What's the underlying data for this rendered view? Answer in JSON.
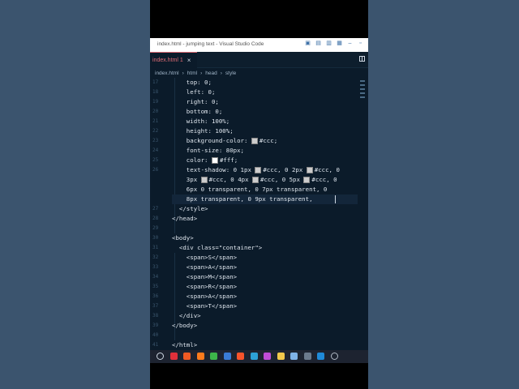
{
  "window": {
    "title": "index.html - jumping text - Visual Studio Code"
  },
  "tab": {
    "label": "index.html 1",
    "close": "×"
  },
  "breadcrumb": {
    "file": "index.html",
    "sep1": "›",
    "item1": "html",
    "sep2": "›",
    "item2": "head",
    "sep3": "›",
    "item3": "style"
  },
  "code_lines": [
    {
      "num": "17",
      "text": "    top: 0;"
    },
    {
      "num": "18",
      "text": "    left: 0;"
    },
    {
      "num": "19",
      "text": "    right: 0;"
    },
    {
      "num": "20",
      "text": "    bottom: 0;"
    },
    {
      "num": "21",
      "text": "    width: 100%;"
    },
    {
      "num": "22",
      "text": "    height: 100%;"
    },
    {
      "num": "23",
      "text": "    background-color: ■#ccc;"
    },
    {
      "num": "24",
      "text": "    font-size: 80px;"
    },
    {
      "num": "25",
      "text": "    color: ■#fff;"
    },
    {
      "num": "26",
      "text": "    text-shadow: 0 1px ■#ccc, 0 2px ■#ccc, 0"
    },
    {
      "num": "",
      "text": "    3px ■#ccc, 0 4px ■#ccc, 0 5px ■#ccc, 0"
    },
    {
      "num": "",
      "text": "    6px 0 transparent, 0 7px transparent, 0"
    },
    {
      "num": "",
      "text": "    8px transparent, 0 9px transparent,"
    },
    {
      "num": "27",
      "text": "  </style>"
    },
    {
      "num": "28",
      "text": "</head>"
    },
    {
      "num": "29",
      "text": ""
    },
    {
      "num": "30",
      "text": "<body>"
    },
    {
      "num": "31",
      "text": "  <div class=\"container\">"
    },
    {
      "num": "32",
      "text": "    <span>S</span>"
    },
    {
      "num": "33",
      "text": "    <span>A</span>"
    },
    {
      "num": "34",
      "text": "    <span>M</span>"
    },
    {
      "num": "35",
      "text": "    <span>R</span>"
    },
    {
      "num": "36",
      "text": "    <span>A</span>"
    },
    {
      "num": "37",
      "text": "    <span>T</span>"
    },
    {
      "num": "38",
      "text": "  </div>"
    },
    {
      "num": "39",
      "text": "</body>"
    },
    {
      "num": "40",
      "text": ""
    },
    {
      "num": "41",
      "text": "</html>"
    }
  ],
  "colors": {
    "editor_bg": "#0b1b2a",
    "accent_tab": "#e06c75",
    "swatch_ccc": "#cccccc",
    "swatch_fff": "#ffffff"
  },
  "taskbar_icons": [
    "search-icon",
    "opera-icon",
    "brave-icon",
    "firefox-icon",
    "chrome-icon",
    "python-icon",
    "brave-lion-icon",
    "edge-icon",
    "app-icon",
    "files-icon",
    "notepad-icon",
    "terminal-icon",
    "vscode-icon",
    "github-icon"
  ]
}
